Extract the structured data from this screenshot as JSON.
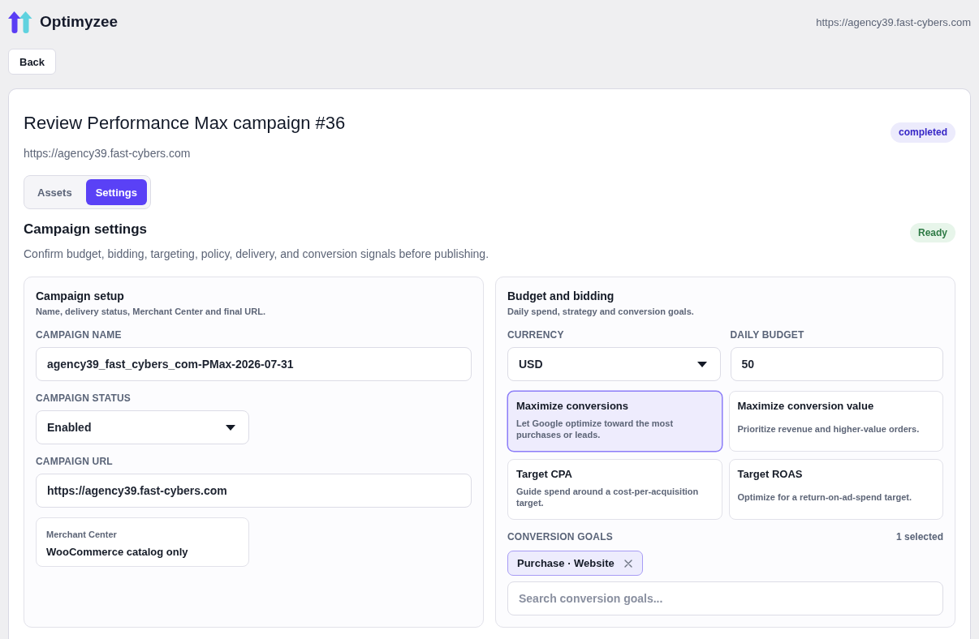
{
  "header": {
    "brand": "Optimyzee",
    "site_url": "https://agency39.fast-cybers.com"
  },
  "back_button": {
    "label": "Back"
  },
  "campaign": {
    "title": "Review Performance Max campaign #36",
    "status_badge": "completed",
    "url": "https://agency39.fast-cybers.com",
    "tabs": [
      {
        "label": "Assets",
        "selected": false
      },
      {
        "label": "Settings",
        "selected": true
      }
    ]
  },
  "settings": {
    "title": "Campaign settings",
    "status_badge": "Ready",
    "description": "Confirm budget, bidding, targeting, policy, delivery, and conversion signals before publishing.",
    "panels": [
      {
        "title": "Campaign setup",
        "subtitle": "Name, delivery status, Merchant Center and final URL.",
        "fields": [
          {
            "kind": "text",
            "label": "CAMPAIGN NAME",
            "value": "agency39_fast_cybers_com-PMax-2026-07-31"
          },
          {
            "kind": "select",
            "label": "CAMPAIGN STATUS",
            "value": "Enabled"
          },
          {
            "kind": "text",
            "label": "CAMPAIGN URL",
            "value": "https://agency39.fast-cybers.com"
          },
          {
            "kind": "info",
            "label": "Merchant Center",
            "value": "WooCommerce catalog only"
          }
        ]
      },
      {
        "title": "Budget and bidding",
        "subtitle": "Daily spend, strategy and conversion goals.",
        "field_row": [
          {
            "kind": "select",
            "label": "CURRENCY",
            "value": "USD"
          },
          {
            "kind": "text",
            "label": "DAILY BUDGET",
            "value": "50"
          }
        ],
        "strategies": [
          {
            "title": "Maximize conversions",
            "description": "Let Google optimize toward the most purchases or leads.",
            "selected": true
          },
          {
            "title": "Maximize conversion value",
            "description": "Prioritize revenue and higher-value orders.",
            "selected": false
          },
          {
            "title": "Target CPA",
            "description": "Guide spend around a cost-per-acquisition target.",
            "selected": false
          },
          {
            "title": "Target ROAS",
            "description": "Optimize for a return-on-ad-spend target.",
            "selected": false
          }
        ],
        "conversion_goals": {
          "label": "CONVERSION GOALS",
          "count": "1 selected",
          "chips": [
            {
              "label": "Purchase · Website"
            }
          ],
          "search": {
            "placeholder": "Search conversion goals..."
          }
        }
      }
    ]
  }
}
